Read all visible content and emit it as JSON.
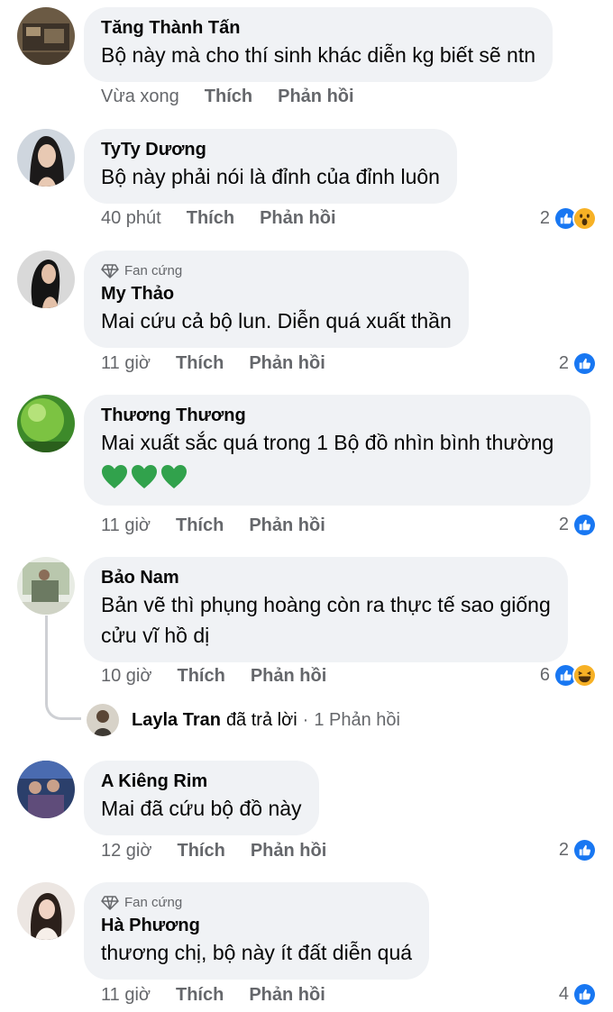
{
  "colors": {
    "like_blue": "#1877f2",
    "bubble_bg": "#f0f2f5",
    "meta_gray": "#65676b",
    "heart_green": "#31a24c"
  },
  "labels": {
    "like": "Thích",
    "reply": "Phản hồi"
  },
  "comments": [
    {
      "author": "Tăng Thành Tấn",
      "badge": "",
      "text_lines": [
        "Bộ này mà cho thí sinh khác diễn kg biết sẽ ntn"
      ],
      "time": "Vừa xong",
      "reaction_count": "",
      "reactions": []
    },
    {
      "author": "TyTy Dương",
      "badge": "",
      "text_lines": [
        "Bộ này phải nói là đỉnh của đỉnh luôn"
      ],
      "time": "40 phút",
      "reaction_count": "2",
      "reactions": [
        "like-icon",
        "wow-icon"
      ]
    },
    {
      "author": "My Thảo",
      "badge": "Fan cứng",
      "text_lines": [
        "Mai cứu cả bộ lun. Diễn quá xuất thần"
      ],
      "time": "11 giờ",
      "reaction_count": "2",
      "reactions": [
        "like-icon"
      ]
    },
    {
      "author": "Thương Thương",
      "badge": "",
      "text_lines": [
        "Mai xuất sắc quá trong 1 Bộ đồ nhìn bình thường"
      ],
      "emoji": "💚💚💚",
      "time": "11 giờ",
      "reaction_count": "2",
      "reactions": [
        "like-icon"
      ]
    },
    {
      "author": "Bảo Nam",
      "badge": "",
      "text_lines": [
        "Bản vẽ thì phụng hoàng còn ra thực tế sao giống",
        "cửu vĩ hồ dị"
      ],
      "time": "10 giờ",
      "reaction_count": "6",
      "reactions": [
        "like-icon",
        "haha-icon"
      ]
    },
    {
      "author": "A Kiêng Rim",
      "badge": "",
      "text_lines": [
        "Mai đã cứu bộ đồ này"
      ],
      "time": "12 giờ",
      "reaction_count": "2",
      "reactions": [
        "like-icon"
      ]
    },
    {
      "author": "Hà Phương",
      "badge": "Fan cứng",
      "text_lines": [
        "thương chị, bộ này ít đất diễn quá"
      ],
      "time": "11 giờ",
      "reaction_count": "4",
      "reactions": [
        "like-icon"
      ]
    }
  ],
  "reply_summary": {
    "author": "Layla Tran",
    "action": "đã trả lời",
    "count": "1 Phản hồi"
  }
}
